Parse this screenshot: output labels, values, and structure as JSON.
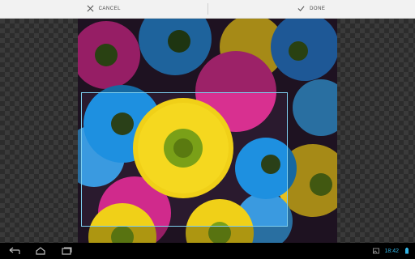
{
  "action_bar": {
    "cancel_label": "CANCEL",
    "done_label": "DONE"
  },
  "crop": {
    "photo_subject": "colorful daisies"
  },
  "status_bar": {
    "time": "18:42"
  },
  "colors": {
    "accent": "#33b5e5",
    "crop_border": "#7fd0f0"
  }
}
